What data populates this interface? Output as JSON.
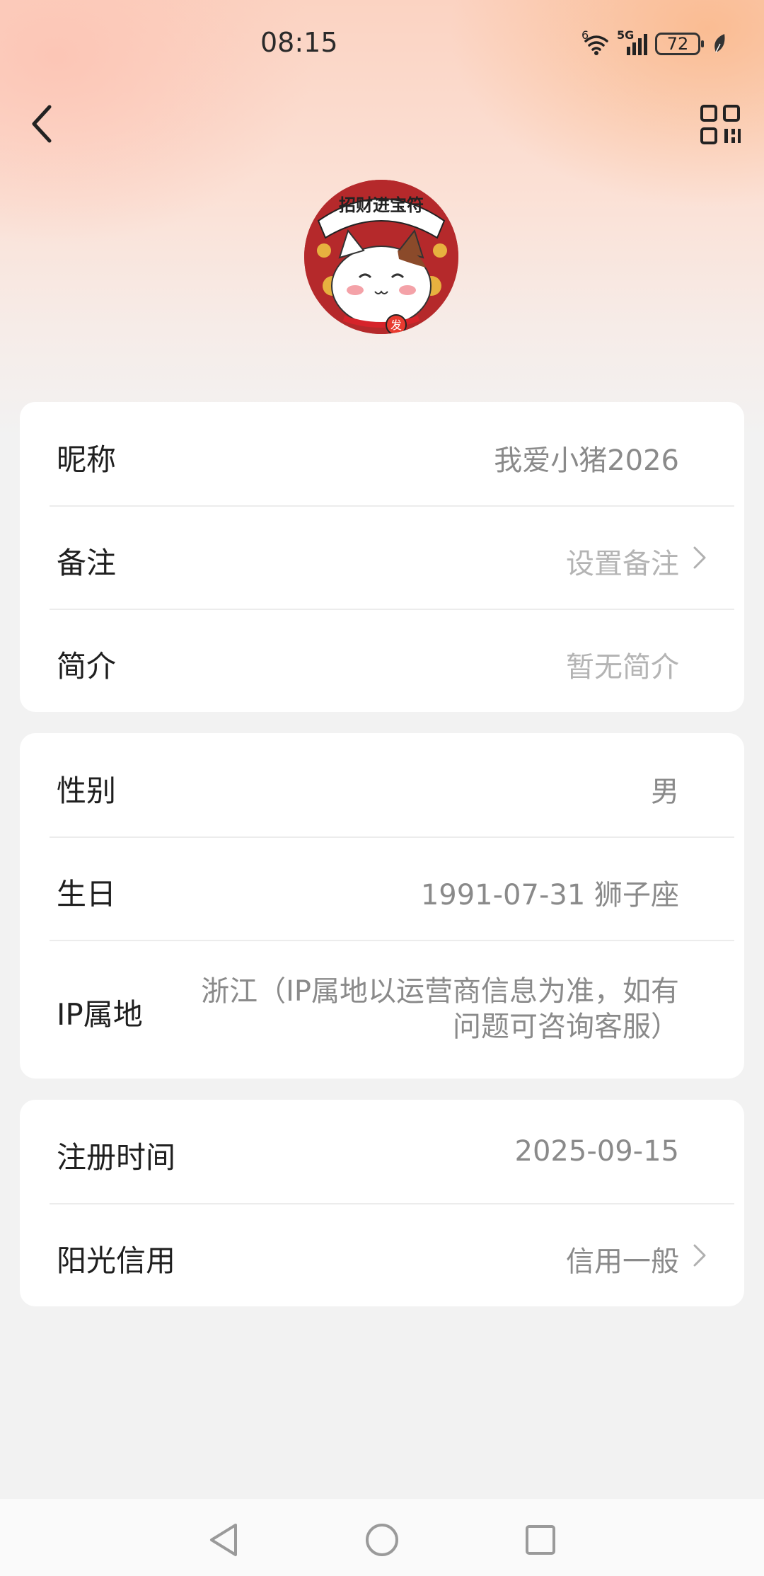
{
  "status_bar": {
    "time": "08:15",
    "signal_label": "5G",
    "wifi_badge": "6",
    "battery": "72"
  },
  "header": {
    "back_icon": "chevron-left-icon",
    "qr_icon": "qr-code-icon"
  },
  "profile": {
    "avatar_caption": "招财进宝符",
    "avatar_badge": "发"
  },
  "basic_info": {
    "nickname_label": "昵称",
    "nickname_value": "我爱小猪2026",
    "remark_label": "备注",
    "remark_value": "设置备注",
    "bio_label": "简介",
    "bio_value": "暂无简介"
  },
  "personal_info": {
    "gender_label": "性别",
    "gender_value": "男",
    "birthday_label": "生日",
    "birthday_value": "1991-07-31 狮子座",
    "ip_label": "IP属地",
    "ip_value": "浙江（IP属地以运营商信息为准，如有问题可咨询客服）"
  },
  "account_info": {
    "register_label": "注册时间",
    "register_value": "2025-09-15",
    "credit_label": "阳光信用",
    "credit_value": "信用一般"
  },
  "colors": {
    "accent_bg": "#fbd3c2",
    "card_bg": "#ffffff",
    "page_bg": "#f2f2f2",
    "value_text": "#8a8a8a",
    "placeholder_text": "#b4b4b4"
  }
}
